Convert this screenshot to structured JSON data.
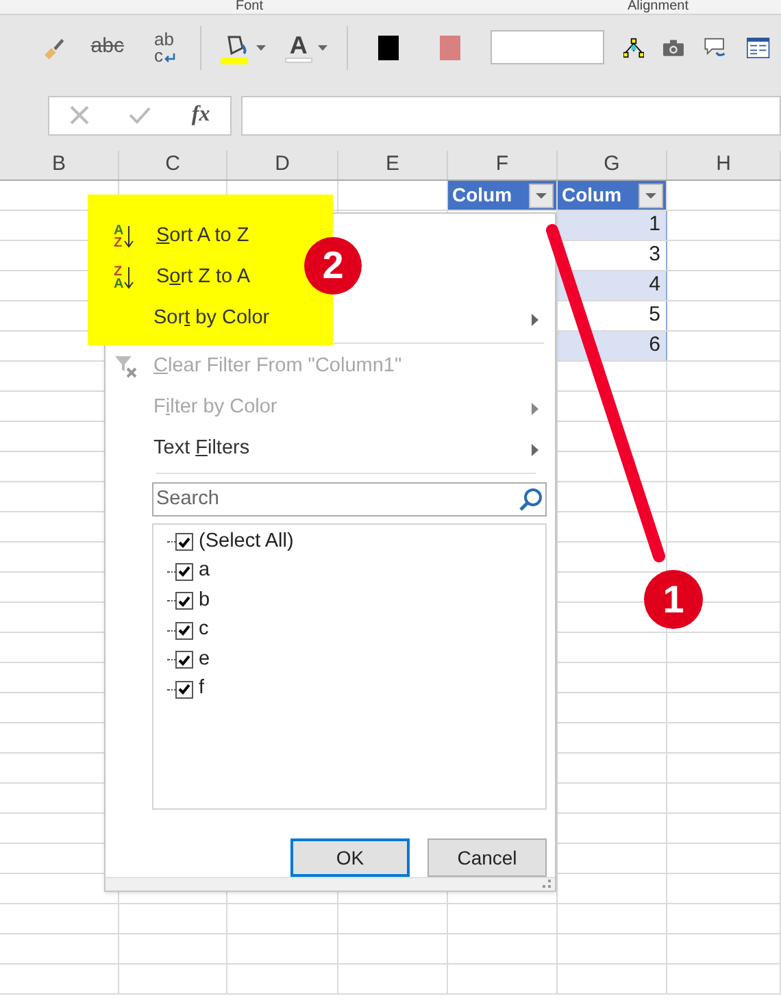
{
  "ribbon": {
    "group_labels": [
      "Font",
      "Alignment"
    ],
    "tools": [
      {
        "kind": "brush"
      },
      {
        "kind": "strike",
        "glyph": "abc"
      },
      {
        "kind": "wrap",
        "glyph": "ab",
        "glyph2": "c"
      },
      {
        "kind": "fill",
        "color": "#ffff00"
      },
      {
        "kind": "fontcolor",
        "glyph": "A",
        "color": "#ffffff"
      },
      {
        "kind": "swatch",
        "color": "#000000"
      },
      {
        "kind": "swatch",
        "color": "#d98080"
      },
      {
        "kind": "box"
      },
      {
        "kind": "diagram"
      },
      {
        "kind": "camera"
      },
      {
        "kind": "comment"
      },
      {
        "kind": "form"
      }
    ]
  },
  "formula_bar": {
    "fx": "fx"
  },
  "columns": [
    "B",
    "C",
    "D",
    "E",
    "F",
    "G",
    "H"
  ],
  "table": {
    "headers": [
      {
        "label": "Colum"
      },
      {
        "label": "Colum"
      }
    ],
    "values": [
      {
        "value": "1",
        "banded": true
      },
      {
        "value": "3",
        "banded": false
      },
      {
        "value": "4",
        "banded": true
      },
      {
        "value": "5",
        "banded": false
      },
      {
        "value": "6",
        "banded": true
      }
    ]
  },
  "filter_menu": {
    "items": [
      {
        "kind": "sort_az",
        "label": [
          {
            "text": "S",
            "underline": true
          },
          {
            "text": "ort A to Z",
            "underline": false
          }
        ],
        "disabled": false,
        "submenu": false,
        "icon_top": "A",
        "icon_bottom": "Z"
      },
      {
        "kind": "sort_za",
        "label": [
          {
            "text": "S",
            "underline": false
          },
          {
            "text": "o",
            "underline": true
          },
          {
            "text": "rt Z to A",
            "underline": false
          }
        ],
        "disabled": false,
        "submenu": false,
        "icon_top": "Z",
        "icon_bottom": "A"
      },
      {
        "kind": "plain",
        "label": [
          {
            "text": "Sor",
            "underline": false
          },
          {
            "text": "t",
            "underline": true
          },
          {
            "text": " by Color",
            "underline": false
          }
        ],
        "disabled": false,
        "submenu": true
      },
      {
        "kind": "divider"
      },
      {
        "kind": "clear",
        "label": [
          {
            "text": "C",
            "underline": true
          },
          {
            "text": "lear Filter From \"Column1\"",
            "underline": false
          }
        ],
        "disabled": true,
        "submenu": false
      },
      {
        "kind": "plain",
        "label": [
          {
            "text": "F",
            "underline": false
          },
          {
            "text": "i",
            "underline": true
          },
          {
            "text": "lter by Color",
            "underline": false
          }
        ],
        "disabled": true,
        "submenu": true
      },
      {
        "kind": "plain",
        "label": [
          {
            "text": "Text ",
            "underline": false
          },
          {
            "text": "F",
            "underline": true
          },
          {
            "text": "ilters",
            "underline": false
          }
        ],
        "disabled": false,
        "submenu": true
      }
    ],
    "search": {
      "placeholder": "Search"
    },
    "values": [
      {
        "label": "(Select All)",
        "checked": true
      },
      {
        "label": "a",
        "checked": true
      },
      {
        "label": "b",
        "checked": true
      },
      {
        "label": "c",
        "checked": true
      },
      {
        "label": "e",
        "checked": true
      },
      {
        "label": "f",
        "checked": true
      }
    ],
    "buttons": [
      {
        "label": "OK",
        "selected": true
      },
      {
        "label": "Cancel",
        "selected": false
      }
    ]
  },
  "annotations": [
    {
      "label": "2"
    },
    {
      "label": "1"
    }
  ]
}
